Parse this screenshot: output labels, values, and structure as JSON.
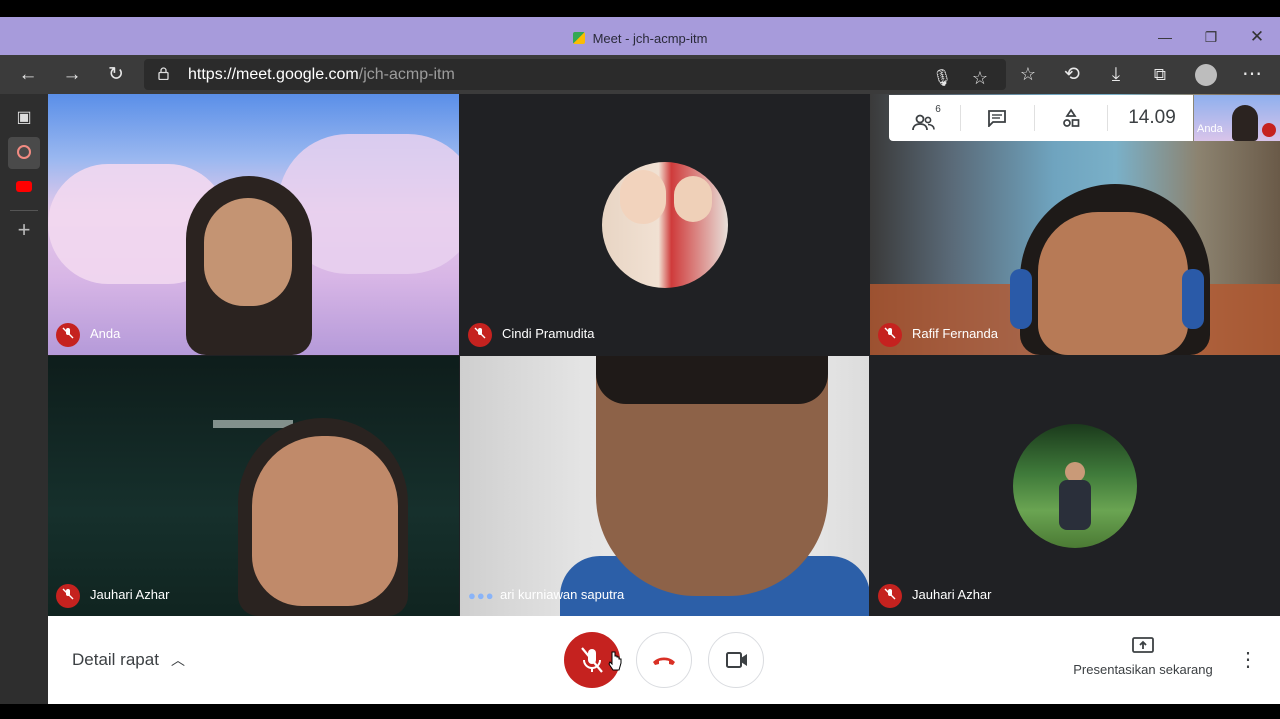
{
  "window": {
    "title": "Meet - jch-acmp-itm",
    "minimize_icon": "minimize-icon",
    "restore_icon": "restore-icon",
    "close_icon": "close-icon"
  },
  "address_bar": {
    "url_host": "https://meet.google.com",
    "url_path": "/jch-acmp-itm"
  },
  "meeting_toolbar": {
    "participants_count": "6",
    "time": "14.09",
    "self_preview_label": "Anda"
  },
  "participants": [
    {
      "name": "Anda",
      "muted": true
    },
    {
      "name": "Cindi Pramudita",
      "muted": true
    },
    {
      "name": "Rafif Fernanda",
      "muted": true
    },
    {
      "name": "Jauhari Azhar",
      "muted": true
    },
    {
      "name": "ari kurniawan saputra",
      "muted": false
    },
    {
      "name": "Jauhari Azhar",
      "muted": true
    }
  ],
  "bottom_bar": {
    "details_label": "Detail rapat",
    "present_label": "Presentasikan sekarang"
  },
  "colors": {
    "title_bar": "#a79bdb",
    "mute_red": "#c5221f",
    "hangup_red": "#d93025",
    "tile_bg": "#202124"
  }
}
